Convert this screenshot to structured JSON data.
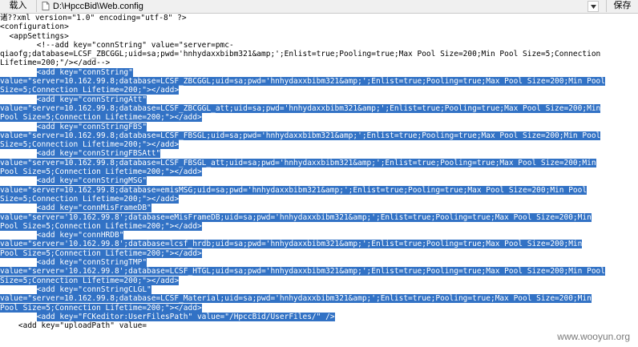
{
  "toolbar": {
    "load_label": "载入",
    "path": "D:\\HpccBid\\Web.config",
    "save_label": "保存"
  },
  "lines": [
    {
      "text": "诸??xml version=\"1.0\" encoding=\"utf-8\" ?>",
      "sel": false
    },
    {
      "text": "<configuration>",
      "sel": false
    },
    {
      "text": "  <appSettings>",
      "sel": false
    },
    {
      "text": "        <!--add key=\"connString\" value=\"server=pmc-",
      "sel": false
    },
    {
      "text": "qiaofg;database=LCSF_ZBCGGL;uid=sa;pwd='hnhydaxxbibm321&amp;';Enlist=true;Pooling=true;Max Pool Size=200;Min Pool Size=5;Connection",
      "sel": false
    },
    {
      "text": "Lifetime=200;\"/>",
      "sel": false,
      "tail": "</add-->"
    },
    {
      "pre": "        ",
      "text": "<add key=\"connString\"",
      "sel": true
    },
    {
      "text": "value=\"server=10.162.99.8;database=LCSF_ZBCGGL;uid=sa;pwd='hnhydaxxbibm321&amp;';Enlist=true;Pooling=true;Max Pool Size=200;Min Pool",
      "sel": true
    },
    {
      "text": "Size=5;Connection Lifetime=200;\"></add>",
      "sel": true
    },
    {
      "pre": "        ",
      "text": "<add key=\"connStringAtt\"",
      "sel": true
    },
    {
      "text": "value=\"server=10.162.99.8;database=LCSF_ZBCGGL_att;uid=sa;pwd='hnhydaxxbibm321&amp;';Enlist=true;Pooling=true;Max Pool Size=200;Min",
      "sel": true
    },
    {
      "text": "Pool Size=5;Connection Lifetime=200;\"></add>",
      "sel": true
    },
    {
      "pre": "        ",
      "text": "<add key=\"connStringFBS\"",
      "sel": true
    },
    {
      "text": "value=\"server=10.162.99.8;database=LCSF_FBSGL;uid=sa;pwd='hnhydaxxbibm321&amp;';Enlist=true;Pooling=true;Max Pool Size=200;Min Pool",
      "sel": true
    },
    {
      "text": "Size=5;Connection Lifetime=200;\"></add>",
      "sel": true
    },
    {
      "pre": "        ",
      "text": "<add key=\"connStringFBSAtt\"",
      "sel": true
    },
    {
      "text": "value=\"server=10.162.99.8;database=LCSF_FBSGL_att;uid=sa;pwd='hnhydaxxbibm321&amp;';Enlist=true;Pooling=true;Max Pool Size=200;Min",
      "sel": true
    },
    {
      "text": "Pool Size=5;Connection Lifetime=200;\"></add>",
      "sel": true
    },
    {
      "pre": "        ",
      "text": "<add key=\"connStringMSG\"",
      "sel": true
    },
    {
      "text": "value=\"server=10.162.99.8;database=emisMSG;uid=sa;pwd='hnhydaxxbibm321&amp;';Enlist=true;Pooling=true;Max Pool Size=200;Min Pool",
      "sel": true
    },
    {
      "text": "Size=5;Connection Lifetime=200;\"></add>",
      "sel": true
    },
    {
      "pre": "        ",
      "text": "<add key=\"connMisFrameDB\"",
      "sel": true
    },
    {
      "text": "value=\"server='10.162.99.8';database=eMisFrameDB;uid=sa;pwd='hnhydaxxbibm321&amp;';Enlist=true;Pooling=true;Max Pool Size=200;Min",
      "sel": true
    },
    {
      "text": "Pool Size=5;Connection Lifetime=200;\"></add>",
      "sel": true
    },
    {
      "pre": "        ",
      "text": "<add key=\"connHRDB\"",
      "sel": true
    },
    {
      "text": "value=\"server='10.162.99.8';database=lcsf_hrdb;uid=sa;pwd='hnhydaxxbibm321&amp;';Enlist=true;Pooling=true;Max Pool Size=200;Min",
      "sel": true
    },
    {
      "text": "Pool Size=5;Connection Lifetime=200;\"></add>",
      "sel": true
    },
    {
      "pre": "        ",
      "text": "<add key=\"connStringTMP\"",
      "sel": true
    },
    {
      "text": "value=\"server='10.162.99.8';database=LCSF_HTGL;uid=sa;pwd='hnhydaxxbibm321&amp;';Enlist=true;Pooling=true;Max Pool Size=200;Min Pool",
      "sel": true
    },
    {
      "text": "Size=5;Connection Lifetime=200;\"></add>",
      "sel": true
    },
    {
      "pre": "        ",
      "text": "<add key=\"connStringCLGL\"",
      "sel": true
    },
    {
      "text": "value=\"server=10.162.99.8;database=LCSF_Material;uid=sa;pwd='hnhydaxxbibm321&amp;';Enlist=true;Pooling=true;Max Pool Size=200;Min",
      "sel": true
    },
    {
      "text": "Pool Size=5;Connection Lifetime=200;\"></add>",
      "sel": true
    },
    {
      "pre": "        ",
      "text": "<add key=\"FCKeditor:UserFilesPath\" value=\"/HpccBid/UserFiles/\" />",
      "sel": true
    },
    {
      "text": "    <add key=\"uploadPath\" value=",
      "sel": false
    }
  ],
  "watermark": "www.wooyun.org",
  "colors": {
    "selection": "#3272c5",
    "toolbar_bg": "#f0f0f0"
  }
}
